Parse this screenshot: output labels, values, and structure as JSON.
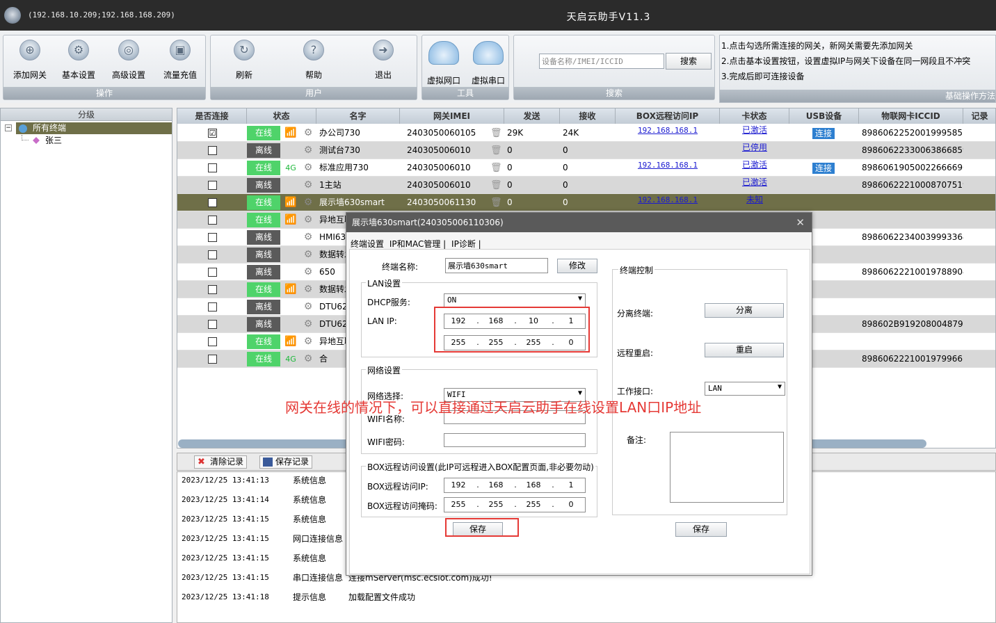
{
  "titlebar": {
    "addr": "(192.168.10.209;192.168.168.209)",
    "title": "天启云助手V11.3"
  },
  "toolbar": {
    "ops": {
      "title": "操作",
      "items": [
        "添加网关",
        "基本设置",
        "高级设置",
        "流量充值"
      ]
    },
    "user": {
      "title": "用户",
      "items": [
        "刷新",
        "帮助",
        "退出"
      ]
    },
    "tools": {
      "title": "工具",
      "items": [
        "虚拟网口",
        "虚拟串口"
      ]
    },
    "search": {
      "title": "搜索",
      "placeholder": "设备名称/IMEI/ICCID",
      "button": "搜索"
    },
    "tips": {
      "title": "基础操作方法",
      "lines": [
        "1.点击勾选所需连接的网关，新网关需要先添加网关",
        "2.点击基本设置按钮，设置虚拟IP与网关下设备在同一网段且不冲突",
        "3.完成后即可连接设备"
      ]
    }
  },
  "tree": {
    "header": "分级",
    "root": "所有终端",
    "child": "张三"
  },
  "grid": {
    "headers": [
      "是否连接",
      "状态",
      "名字",
      "网关IMEI",
      "发送",
      "接收",
      "BOX远程访问IP",
      "卡状态",
      "USB设备",
      "物联网卡ICCID",
      "记录"
    ],
    "rows": [
      {
        "checked": "☑",
        "status": "在线",
        "on": true,
        "sig": "wifi",
        "name": "办公司730",
        "imei": "2403050060105",
        "send": "29K",
        "recv": "24K",
        "boxip": "192.168.168.1",
        "card": "已激活",
        "usb": "连接",
        "iccid": "89860622520019995857"
      },
      {
        "checked": "",
        "status": "离线",
        "on": false,
        "sig": "",
        "name": "测试台730",
        "imei": "240305006010",
        "send": "0",
        "recv": "0",
        "boxip": "",
        "card": "已停用",
        "usb": "",
        "iccid": "89860622330063866859"
      },
      {
        "checked": "",
        "status": "在线",
        "on": true,
        "sig": "4g",
        "name": "标准应用730",
        "imei": "240305006010",
        "send": "0",
        "recv": "0",
        "boxip": "192.168.168.1",
        "card": "已激活",
        "usb": "连接",
        "iccid": "89860619050022666696"
      },
      {
        "checked": "",
        "status": "离线",
        "on": false,
        "sig": "",
        "name": "1主站",
        "imei": "240305006010",
        "send": "0",
        "recv": "0",
        "boxip": "",
        "card": "已激活",
        "usb": "",
        "iccid": "89860622210008707519"
      },
      {
        "checked": "",
        "status": "在线",
        "on": true,
        "sig": "wifi",
        "name": "展示墙630smart",
        "imei": "2403050061130",
        "send": "0",
        "recv": "0",
        "boxip": "192.168.168.1",
        "card": "未知",
        "usb": "",
        "iccid": ""
      },
      {
        "checked": "",
        "status": "在线",
        "on": true,
        "sig": "wifi",
        "name": "异地互联",
        "imei": "",
        "send": "",
        "recv": "",
        "boxip": "",
        "card": "",
        "usb": "",
        "iccid": ""
      },
      {
        "checked": "",
        "status": "离线",
        "on": false,
        "sig": "",
        "name": "HMI630",
        "imei": "",
        "send": "",
        "recv": "",
        "boxip": "",
        "card": "",
        "usb": "",
        "iccid": "89860622340039993364"
      },
      {
        "checked": "",
        "status": "离线",
        "on": false,
        "sig": "",
        "name": "数据转发",
        "imei": "",
        "send": "",
        "recv": "",
        "boxip": "",
        "card": "",
        "usb": "",
        "iccid": ""
      },
      {
        "checked": "",
        "status": "离线",
        "on": false,
        "sig": "",
        "name": "650",
        "imei": "",
        "send": "",
        "recv": "",
        "boxip": "",
        "card": "",
        "usb": "",
        "iccid": "89860622210019788904"
      },
      {
        "checked": "",
        "status": "在线",
        "on": true,
        "sig": "wifi",
        "name": "数据转发",
        "imei": "",
        "send": "",
        "recv": "",
        "boxip": "",
        "card": "",
        "usb": "",
        "iccid": ""
      },
      {
        "checked": "",
        "status": "离线",
        "on": false,
        "sig": "",
        "name": "DTU620",
        "imei": "",
        "send": "",
        "recv": "",
        "boxip": "",
        "card": "",
        "usb": "",
        "iccid": ""
      },
      {
        "checked": "",
        "status": "离线",
        "on": false,
        "sig": "",
        "name": "DTU620",
        "imei": "",
        "send": "",
        "recv": "",
        "boxip": "",
        "card": "",
        "usb": "",
        "iccid": "898602B9192080048799"
      },
      {
        "checked": "",
        "status": "在线",
        "on": true,
        "sig": "wifi",
        "name": "异地互联",
        "imei": "",
        "send": "",
        "recv": "",
        "boxip": "",
        "card": "",
        "usb": "",
        "iccid": ""
      },
      {
        "checked": "",
        "status": "在线",
        "on": true,
        "sig": "4g",
        "name": "合",
        "imei": "",
        "send": "",
        "recv": "",
        "boxip": "",
        "card": "",
        "usb": "",
        "iccid": "89860622210019799661"
      }
    ]
  },
  "logbar": {
    "clear": "清除记录",
    "save": "保存记录"
  },
  "log": [
    {
      "ts": "2023/12/25 13:41:13",
      "type": "系统信息",
      "msg": ""
    },
    {
      "ts": "2023/12/25 13:41:14",
      "type": "系统信息",
      "msg": ""
    },
    {
      "ts": "2023/12/25 13:41:15",
      "type": "系统信息",
      "msg": ""
    },
    {
      "ts": "2023/12/25 13:41:15",
      "type": "网口连接信息",
      "msg": ""
    },
    {
      "ts": "2023/12/25 13:41:15",
      "type": "系统信息",
      "msg": ""
    },
    {
      "ts": "2023/12/25 13:41:15",
      "type": "串口连接信息",
      "msg": "连接mServer(msc.ecsiot.com)成功!"
    },
    {
      "ts": "2023/12/25 13:41:18",
      "type": "提示信息",
      "msg": "加载配置文件成功"
    }
  ],
  "dialog": {
    "title": "展示墙630smart(240305006110306)",
    "tabs": [
      "终端设置",
      "IP和MAC管理 |",
      "IP诊断 |"
    ],
    "name_label": "终端名称:",
    "name_value": "展示墙630smart",
    "modify": "修改",
    "lan": {
      "legend": "LAN设置",
      "dhcp_label": "DHCP服务:",
      "dhcp_value": "ON",
      "ip_label": "LAN IP:",
      "ip": [
        "192",
        "168",
        "10",
        "1"
      ],
      "mask": [
        "255",
        "255",
        "255",
        "0"
      ]
    },
    "net": {
      "legend": "网络设置",
      "select_label": "网络选择:",
      "select_value": "WIFI",
      "wifi_name_label": "WIFI名称:",
      "wifi_pwd_label": "WIFI密码:"
    },
    "box": {
      "legend": "BOX远程访问设置(此IP可远程进入BOX配置页面,非必要勿动)",
      "ip_label": "BOX远程访问IP:",
      "ip": [
        "192",
        "168",
        "168",
        "1"
      ],
      "mask_label": "BOX远程访问掩码:",
      "mask": [
        "255",
        "255",
        "255",
        "0"
      ]
    },
    "save": "保存",
    "ctrl": {
      "legend": "终端控制",
      "sep_label": "分离终端:",
      "sep_btn": "分离",
      "reboot_label": "远程重启:",
      "reboot_btn": "重启",
      "iface_label": "工作接口:",
      "iface_value": "LAN",
      "memo_label": "备注:",
      "save": "保存"
    }
  },
  "annotation": "网关在线的情况下，可以直接通过天启云助手在线设置LAN口IP地址"
}
